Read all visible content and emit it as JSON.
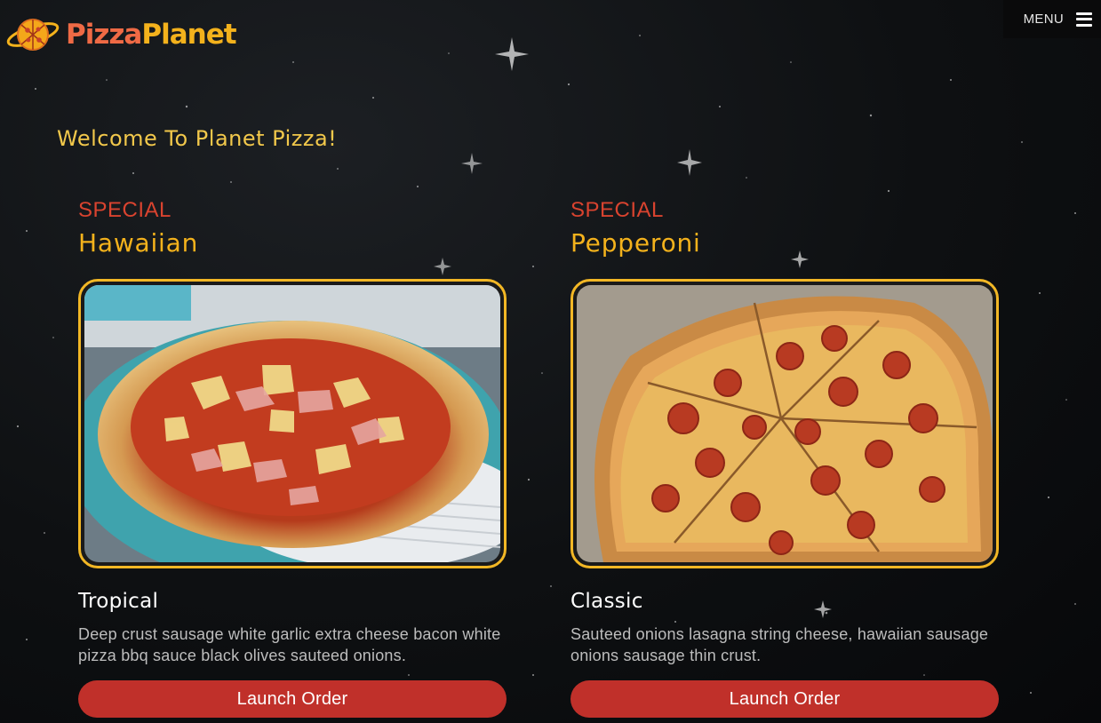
{
  "header": {
    "logo_part1": "Pizza",
    "logo_part2": "Planet",
    "menu_label": "MENU",
    "menu_icon": "hamburger-icon"
  },
  "welcome": "Welcome To Planet Pizza!",
  "cards": [
    {
      "special": "SPECIAL",
      "name": "Hawaiian",
      "subtitle": "Tropical",
      "description": "Deep crust sausage white garlic extra cheese bacon white pizza bbq sauce black olives sauteed onions.",
      "button": "Launch Order"
    },
    {
      "special": "SPECIAL",
      "name": "Pepperoni",
      "subtitle": "Classic",
      "description": "Sauteed onions lasagna string cheese, hawaiian sausage onions sausage thin crust.",
      "button": "Launch Order"
    }
  ],
  "colors": {
    "accent_gold": "#f2b725",
    "special_red": "#d9432f",
    "button_red": "#c0302a"
  }
}
